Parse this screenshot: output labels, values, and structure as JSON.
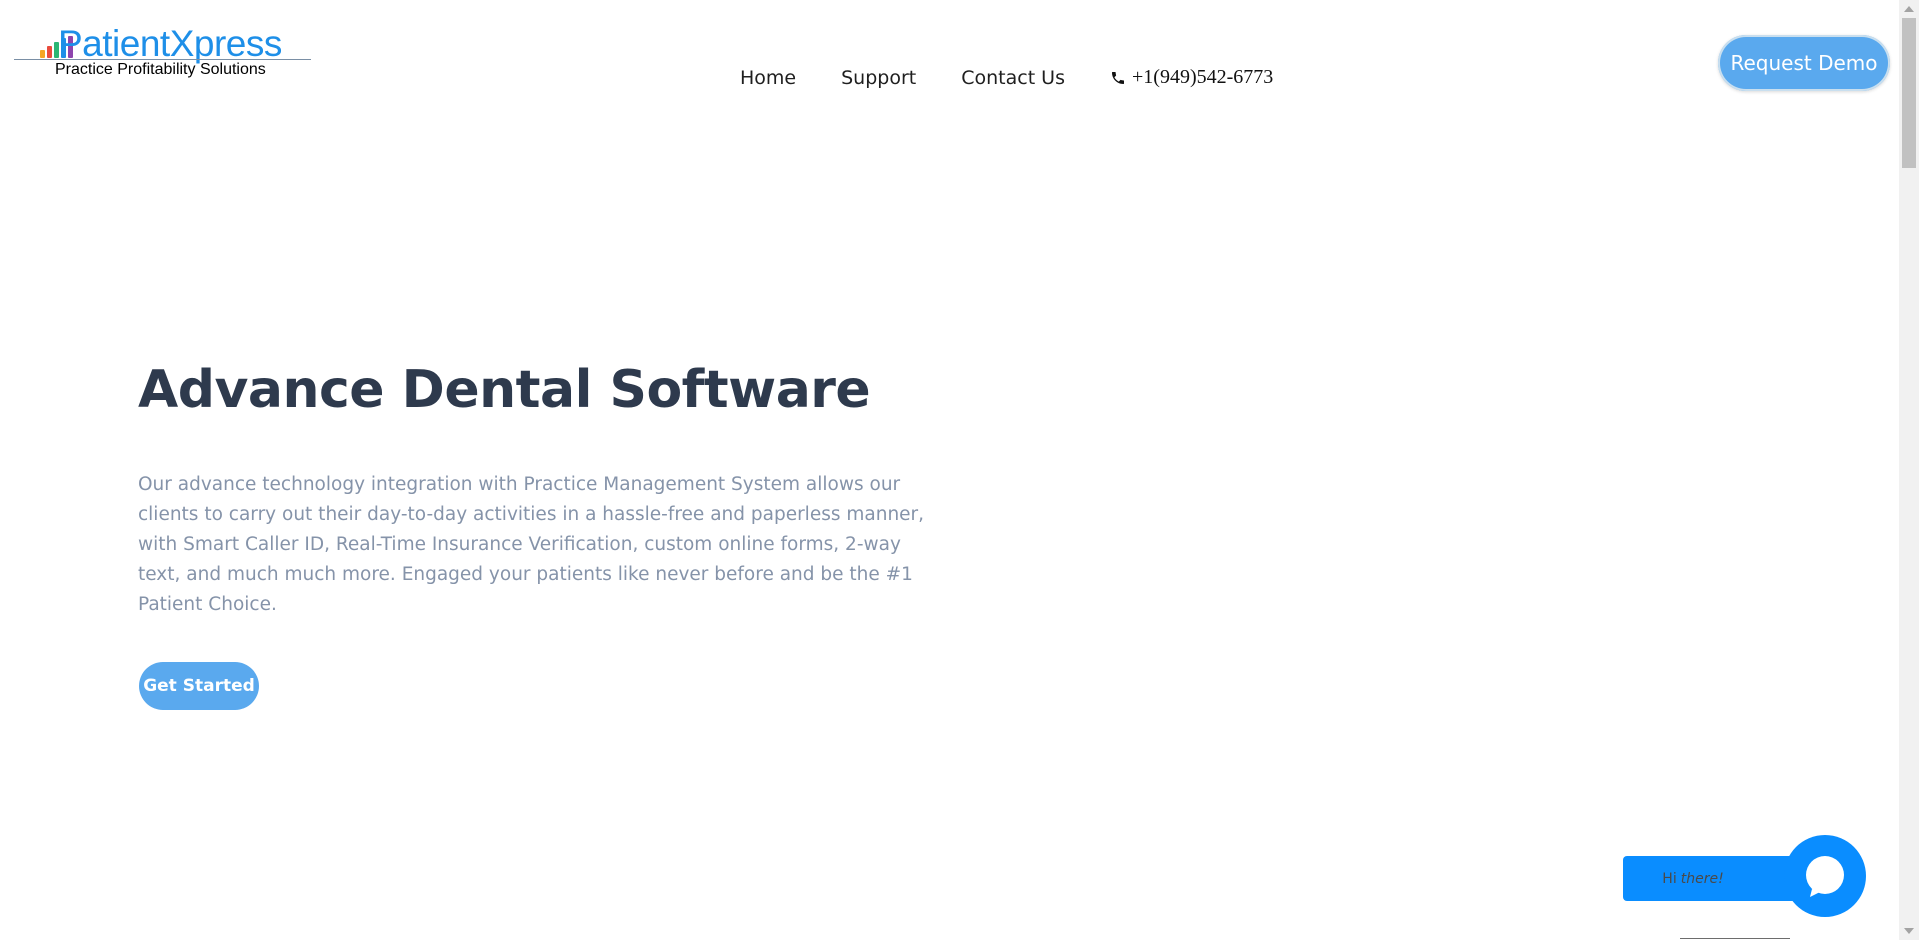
{
  "header": {
    "logo": {
      "name": "PatientXpress",
      "tagline": "Practice Profitability Solutions",
      "bar_colors": [
        "#f5a623",
        "#e94b3c",
        "#2bb673",
        "#1e8fe8",
        "#8e44ad"
      ]
    },
    "nav": {
      "home": "Home",
      "support": "Support",
      "contact": "Contact Us",
      "phone": "+1(949)542-6773"
    },
    "request_demo": "Request Demo"
  },
  "hero": {
    "title": "Advance Dental Software",
    "description": "Our advance technology integration with Practice Management System allows our clients to carry out their day-to-day activities in a hassle-free and paperless manner, with Smart Caller ID, Real-Time Insurance Verification, custom online forms, 2-way text, and much much more. Engaged your  patients like never before and be the #1 Patient Choice.",
    "cta": "Get Started"
  },
  "chat": {
    "greeting_hi": "Hi",
    "greeting_there": "there!",
    "icon": "chat-icon"
  },
  "colors": {
    "brand_blue": "#1e8fe8",
    "button_blue": "#5aa9ee",
    "chat_blue": "#0a8dff",
    "title_color": "#2e3a4d",
    "text_color": "#8593a9"
  }
}
